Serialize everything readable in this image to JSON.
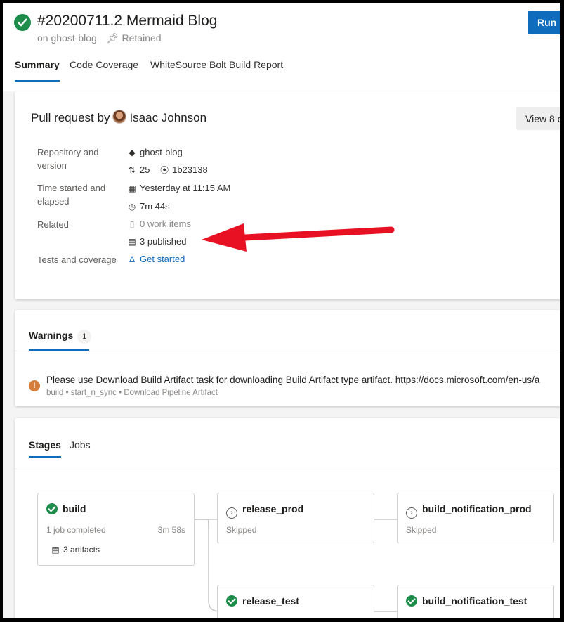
{
  "header": {
    "run_title": "#20200711.2 Mermaid Blog",
    "repo_prefix": "on ghost-blog",
    "retained": "Retained",
    "run_button": "Run n"
  },
  "tabs": [
    "Summary",
    "Code Coverage",
    "WhiteSource Bolt Build Report"
  ],
  "summary": {
    "pr_prefix": "Pull request by",
    "pr_author": "Isaac Johnson",
    "view_button": "View 8 c",
    "rows": {
      "repo_label": "Repository and version",
      "repo_name": "ghost-blog",
      "pr_number": "25",
      "commit": "1b23138",
      "time_label": "Time started and elapsed",
      "started": "Yesterday at 11:15 AM",
      "elapsed": "7m 44s",
      "related_label": "Related",
      "work_items": "0 work items",
      "published": "3 published",
      "tests_label": "Tests and coverage",
      "tests_link": "Get started"
    }
  },
  "warnings": {
    "tab": "Warnings",
    "count": "1",
    "message": "Please use Download Build Artifact task for downloading Build Artifact type artifact. https://docs.microsoft.com/en-us/a",
    "source": "build • start_n_sync • Download Pipeline Artifact"
  },
  "stages_panel": {
    "tab_stages": "Stages",
    "tab_jobs": "Jobs",
    "build": {
      "name": "build",
      "status": "1 job completed",
      "duration": "3m 58s",
      "artifacts": "3 artifacts"
    },
    "release_prod": {
      "name": "release_prod",
      "status": "Skipped"
    },
    "build_notification_prod": {
      "name": "build_notification_prod",
      "status": "Skipped"
    },
    "release_test": {
      "name": "release_test"
    },
    "build_notification_test": {
      "name": "build_notification_test"
    }
  },
  "colors": {
    "accent": "#0f6cbd",
    "success": "#1e8d4b",
    "warning": "#d67f3c",
    "annotation_arrow": "#e81123"
  }
}
